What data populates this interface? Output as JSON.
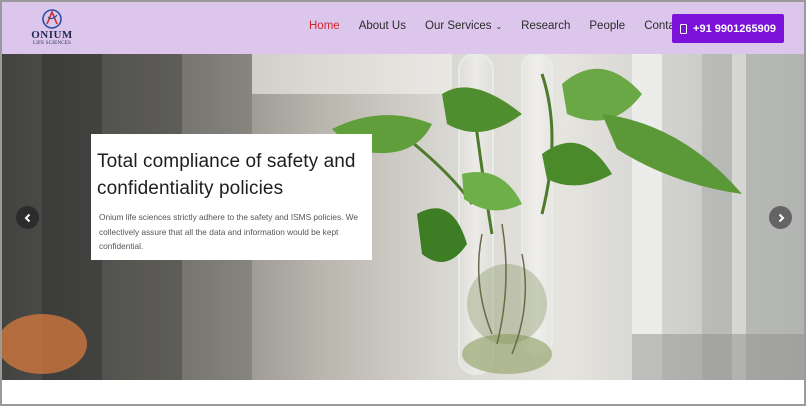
{
  "header": {
    "logo": {
      "name": "ONIUM",
      "subtitle": "LIFE SCIENCES"
    },
    "nav": [
      {
        "label": "Home",
        "active": true
      },
      {
        "label": "About Us"
      },
      {
        "label": "Our Services",
        "icon": "chevron-down-icon",
        "chevron": "⌄"
      },
      {
        "label": "Research"
      },
      {
        "label": "People"
      },
      {
        "label": "Contacts"
      }
    ],
    "phone": {
      "label": "+91 9901265909",
      "icon": "phone-icon"
    },
    "colors": {
      "bar": "#dcc6ec",
      "button": "#7b12d9",
      "active": "#d0262f"
    }
  },
  "slider": {
    "title": "Total compliance of safety and confidentiality policies",
    "text": "Onium life sciences strictly adhere to the safety and ISMS policies. We collectively assure that all the data and information would be kept confidential.",
    "prev_icon": "chevron-left-icon",
    "next_icon": "chevron-right-icon"
  }
}
